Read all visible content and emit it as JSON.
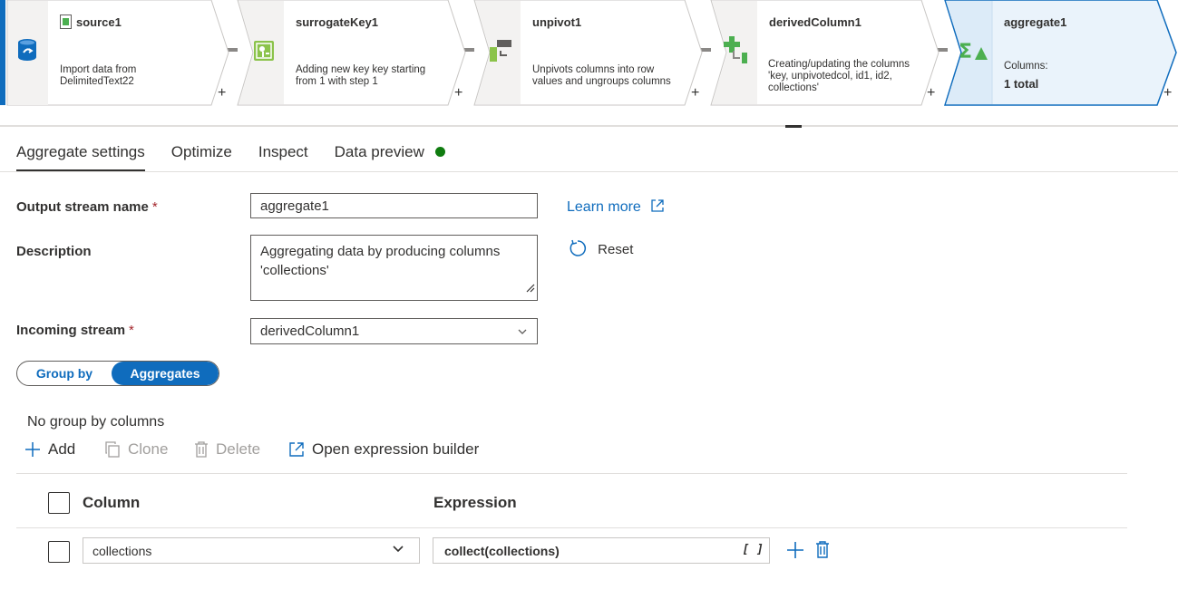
{
  "colors": {
    "accent": "#0f6cbd",
    "required": "#a4262c",
    "status_ok": "#107c10",
    "selected_node_bg": "#eaf3fb",
    "node_icon_green": "#4caf50"
  },
  "pipeline": {
    "nodes": [
      {
        "title": "source1",
        "description": "Import data from DelimitedText22",
        "icon": "source-database-icon"
      },
      {
        "title": "surrogateKey1",
        "description": "Adding new key key starting from 1 with step 1",
        "icon": "surrogate-key-icon"
      },
      {
        "title": "unpivot1",
        "description": "Unpivots columns into row values and ungroups columns",
        "icon": "unpivot-icon"
      },
      {
        "title": "derivedColumn1",
        "description": "Creating/updating the columns 'key, unpivotedcol, id1, id2, collections'",
        "icon": "derived-column-icon"
      },
      {
        "title": "aggregate1",
        "description": "Columns:",
        "description_value": "1 total",
        "icon": "aggregate-icon"
      }
    ],
    "add_symbol": "+"
  },
  "tabs": [
    {
      "label": "Aggregate settings",
      "active": true
    },
    {
      "label": "Optimize",
      "active": false
    },
    {
      "label": "Inspect",
      "active": false
    },
    {
      "label": "Data preview",
      "active": false
    }
  ],
  "form": {
    "output_stream_label": "Output stream name",
    "output_stream_value": "aggregate1",
    "required_marker": "*",
    "description_label": "Description",
    "description_value": "Aggregating data by producing columns 'collections'",
    "incoming_stream_label": "Incoming stream",
    "incoming_stream_value": "derivedColumn1",
    "learn_more": "Learn more",
    "reset": "Reset"
  },
  "toggle": {
    "group_by": "Group by",
    "aggregates": "Aggregates"
  },
  "group_by": {
    "empty_text": "No group by columns"
  },
  "toolbar": {
    "add": "Add",
    "clone": "Clone",
    "delete": "Delete",
    "open_expression_builder": "Open expression builder"
  },
  "table": {
    "column_header": "Column",
    "expression_header": "Expression",
    "rows": [
      {
        "column": "collections",
        "expression": "collect(collections)",
        "expression_hint": "[ ]"
      }
    ]
  }
}
